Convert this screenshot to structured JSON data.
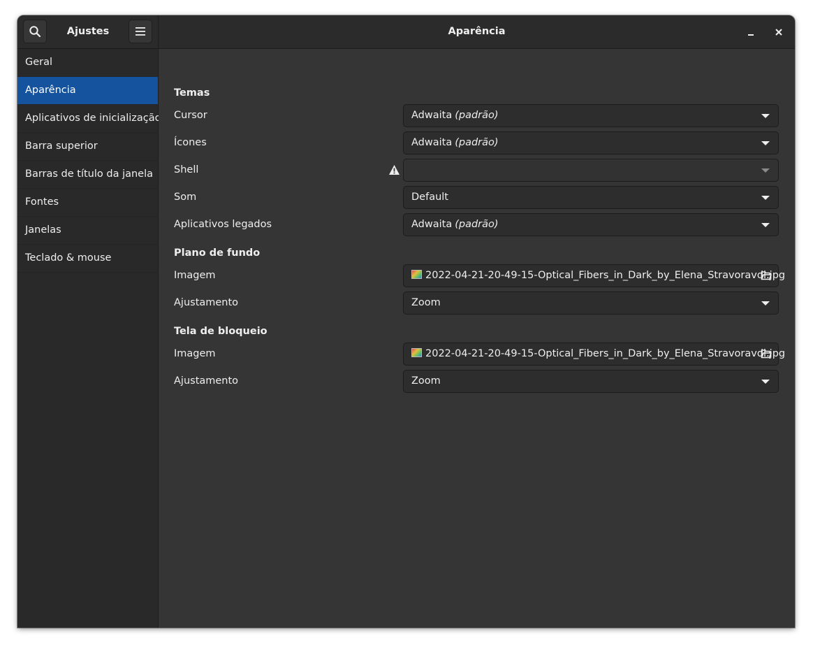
{
  "header": {
    "app_title": "Ajustes",
    "page_title": "Aparência",
    "icons": {
      "search": "search-icon",
      "menu": "hamburger-menu-icon",
      "minimize": "minimize-icon",
      "close": "close-icon"
    }
  },
  "sidebar": {
    "selected": "Aparência",
    "items": [
      {
        "label": "Geral"
      },
      {
        "label": "Aparência"
      },
      {
        "label": "Aplicativos de inicialização"
      },
      {
        "label": "Barra superior"
      },
      {
        "label": "Barras de título da janela"
      },
      {
        "label": "Fontes"
      },
      {
        "label": "Janelas"
      },
      {
        "label": "Teclado & mouse"
      }
    ]
  },
  "main": {
    "themes": {
      "title": "Temas",
      "cursor": {
        "label": "Cursor",
        "value": "Adwaita",
        "suffix": "(padrão)"
      },
      "icons": {
        "label": "Ícones",
        "value": "Adwaita",
        "suffix": "(padrão)"
      },
      "shell": {
        "label": "Shell",
        "value": "",
        "warning_icon": "warning-icon"
      },
      "sound": {
        "label": "Som",
        "value": "Default"
      },
      "legacy": {
        "label": "Aplicativos legados",
        "value": "Adwaita",
        "suffix": "(padrão)"
      }
    },
    "background": {
      "title": "Plano de fundo",
      "image": {
        "label": "Imagem",
        "file": "2022-04-21-20-49-15-Optical_Fibers_in_Dark_by_Elena_Stravoravdi.jpg"
      },
      "adjustment": {
        "label": "Ajustamento",
        "value": "Zoom"
      }
    },
    "lockscreen": {
      "title": "Tela de bloqueio",
      "image": {
        "label": "Imagem",
        "file": "2022-04-21-20-49-15-Optical_Fibers_in_Dark_by_Elena_Stravoravdi.jpg"
      },
      "adjustment": {
        "label": "Ajustamento",
        "value": "Zoom"
      }
    }
  },
  "colors": {
    "selection": "#15539e",
    "window_bg": "#353535",
    "sidebar_bg": "#292929",
    "header_bg": "#2b2b2b"
  }
}
